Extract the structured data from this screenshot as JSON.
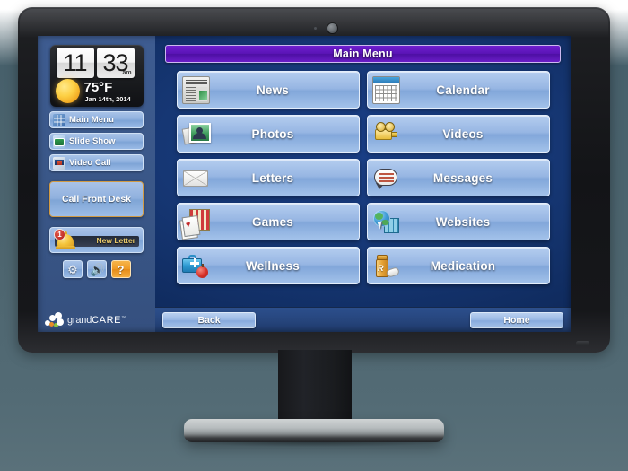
{
  "device": {
    "type": "desktop-monitor",
    "webcam": "webcam-icon"
  },
  "sidebar": {
    "clock": {
      "hours": "11",
      "minutes": "33",
      "meridiem": "am",
      "temperature": "75°F",
      "date": "Jan 14th, 2014",
      "weather_icon": "sun-icon"
    },
    "nav_items": [
      {
        "label": "Main Menu",
        "icon": "grid-icon"
      },
      {
        "label": "Slide Show",
        "icon": "slideshow-icon"
      },
      {
        "label": "Video Call",
        "icon": "video-call-icon"
      }
    ],
    "call_front_desk": {
      "label": "Call Front Desk"
    },
    "alert": {
      "label": "New Letter",
      "count": "1",
      "icon": "bell-icon"
    },
    "quick_buttons": [
      {
        "name": "settings",
        "icon": "gear-icon",
        "glyph": "⚙"
      },
      {
        "name": "volume",
        "icon": "speaker-icon",
        "glyph": "🔊"
      },
      {
        "name": "help",
        "icon": "question-icon",
        "glyph": "?"
      }
    ],
    "logo": {
      "text_grand": "grand",
      "text_care": "CARE",
      "trademark": "™",
      "dot_colors": [
        "#ffffff",
        "#ffffff",
        "#ffffff",
        "#e98c2a",
        "#8cc63f",
        "#ffffff"
      ]
    }
  },
  "main": {
    "title": "Main Menu",
    "tiles": [
      {
        "label": "News",
        "icon": "news-icon"
      },
      {
        "label": "Calendar",
        "icon": "calendar-icon"
      },
      {
        "label": "Photos",
        "icon": "photos-icon"
      },
      {
        "label": "Videos",
        "icon": "video-camera-icon"
      },
      {
        "label": "Letters",
        "icon": "envelope-icon"
      },
      {
        "label": "Messages",
        "icon": "speech-bubble-icon"
      },
      {
        "label": "Games",
        "icon": "playing-cards-icon"
      },
      {
        "label": "Websites",
        "icon": "globe-icon"
      },
      {
        "label": "Wellness",
        "icon": "medical-bag-icon"
      },
      {
        "label": "Medication",
        "icon": "pill-bottle-icon"
      }
    ]
  },
  "bottom_bar": {
    "back_label": "Back",
    "home_label": "Home"
  },
  "colors": {
    "title_purple": "#5a14b6",
    "sidebar_blue": "#3a5788",
    "main_blue": "#163774",
    "tile_blue": "#97b6e3",
    "accent_orange": "#d19a43",
    "badge_red": "#b41f16",
    "page_background": "#4d656f"
  }
}
